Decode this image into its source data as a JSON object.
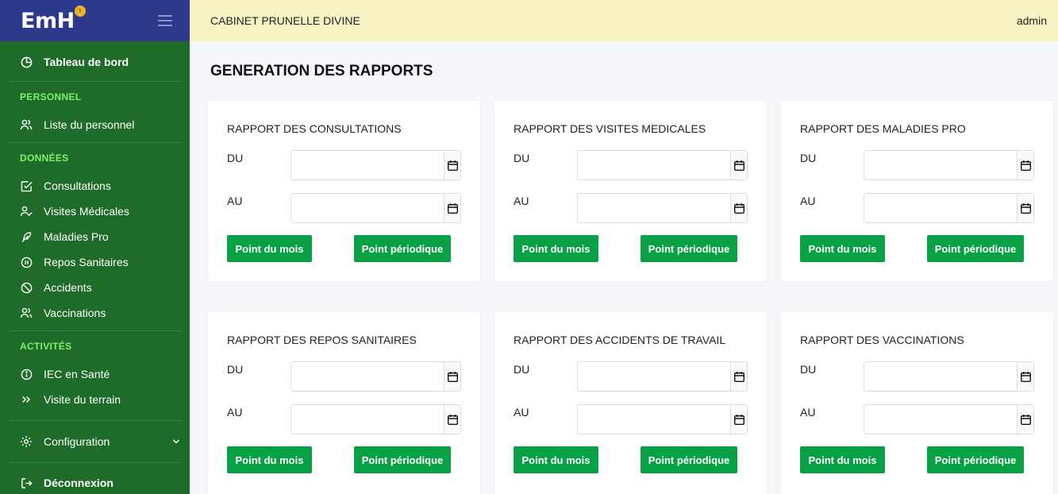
{
  "brand": {
    "logo_text": "EmH",
    "badge": "⚕"
  },
  "topbar": {
    "clinic_name": "CABINET PRUNELLE DIVINE",
    "user": "admin"
  },
  "sidebar": {
    "dashboard": "Tableau de bord",
    "sections": {
      "personnel": "PERSONNEL",
      "donnees": "DONNÉES",
      "activites": "ACTIVITÉS"
    },
    "items": {
      "liste_personnel": "Liste du personnel",
      "consultations": "Consultations",
      "visites_medicales": "Visites Médicales",
      "maladies_pro": "Maladies Pro",
      "repos_sanitaires": "Repos Sanitaires",
      "accidents": "Accidents",
      "vaccinations": "Vaccinations",
      "iec_sante": "IEC en Santé",
      "visite_terrain": "Visite du terrain",
      "configuration": "Configuration",
      "deconnexion": "Déconnexion"
    }
  },
  "main": {
    "title": "GENERATION DES RAPPORTS",
    "labels": {
      "du": "DU",
      "au": "AU"
    },
    "buttons": {
      "month": "Point du mois",
      "period": "Point périodique"
    },
    "cards": [
      {
        "title": "RAPPORT DES CONSULTATIONS",
        "du_value": "",
        "au_value": ""
      },
      {
        "title": "RAPPORT DES VISITES MEDICALES",
        "du_value": "",
        "au_value": ""
      },
      {
        "title": "RAPPORT DES MALADIES PRO",
        "du_value": "",
        "au_value": ""
      },
      {
        "title": "RAPPORT DES REPOS SANITAIRES",
        "du_value": "",
        "au_value": ""
      },
      {
        "title": "RAPPORT DES ACCIDENTS DE TRAVAIL",
        "du_value": "",
        "au_value": ""
      },
      {
        "title": "RAPPORT DES VACCINATIONS",
        "du_value": "",
        "au_value": ""
      }
    ]
  },
  "colors": {
    "sidebar_bg": "#1e6b2a",
    "brand_bg": "#2d3a8c",
    "section_label": "#7ef06a",
    "topbar_bg": "#f8f3c4",
    "button_green": "#08a045"
  }
}
